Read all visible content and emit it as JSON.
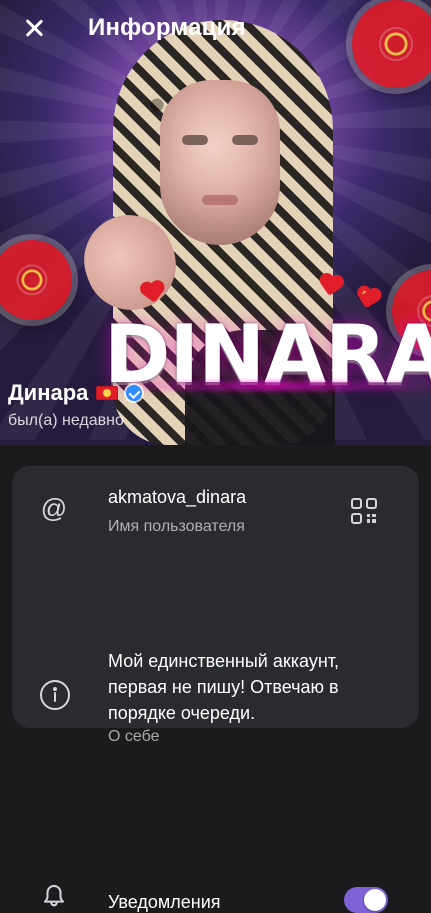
{
  "header": {
    "title": "Информация"
  },
  "hero": {
    "overlay_text": "DINARA"
  },
  "profile": {
    "name": "Динара",
    "status": "был(а) недавно",
    "badges": [
      "kyrgyzstan-flag-icon",
      "verified-icon"
    ]
  },
  "info": {
    "username_value": "akmatova_dinara",
    "username_label": "Имя пользователя",
    "bio_value": "Мой единственный аккаунт, первая не пишу! Отвечаю в порядке очереди.",
    "bio_label": "О себе",
    "notifications_label": "Уведомления",
    "notifications_enabled": true
  },
  "colors": {
    "background": "#1b1b1d",
    "card": "#2a2b2e",
    "accent_toggle": "#7d63d6",
    "verified": "#2f8cff"
  },
  "icons": {
    "close": "close-icon",
    "at": "at-icon",
    "qr": "qr-code-icon",
    "info": "info-icon",
    "bell": "bell-icon"
  }
}
